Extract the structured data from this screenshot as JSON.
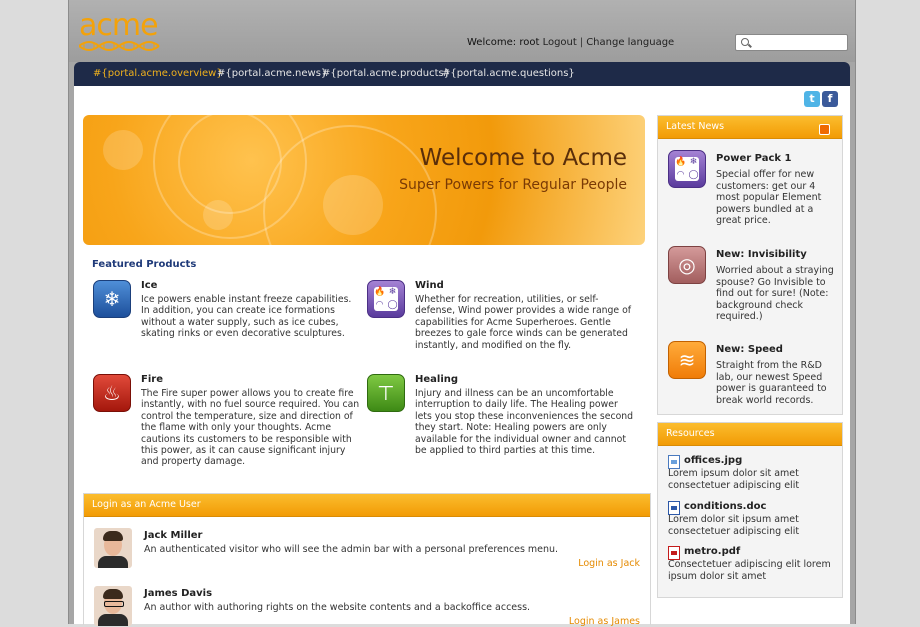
{
  "header": {
    "logo_text": "acme",
    "welcome_label": "Welcome:",
    "username": "root",
    "logout_label": "Logout",
    "separator": "|",
    "change_language_label": "Change language",
    "search_placeholder": ""
  },
  "nav": {
    "tabs": [
      {
        "label": "#{portal.acme.overview}",
        "active": true
      },
      {
        "label": "#{portal.acme.news}",
        "active": false
      },
      {
        "label": "#{portal.acme.products}",
        "active": false
      },
      {
        "label": "#{portal.acme.questions}",
        "active": false
      }
    ]
  },
  "social": {
    "twitter": "t",
    "facebook": "f"
  },
  "banner": {
    "title": "Welcome to Acme",
    "subtitle": "Super Powers for Regular People"
  },
  "featured": {
    "title": "Featured Products",
    "products": [
      {
        "name": "Ice",
        "icon": "snowflake-icon",
        "desc": "Ice powers enable instant freeze capabilities. In addition, you can create ice formations without a water supply, such as ice cubes, skating rinks or even decorative sculptures."
      },
      {
        "name": "Wind",
        "icon": "elements-icon",
        "desc": "Whether for recreation, utilities, or self-defense, Wind power provides a wide range of capabilities for Acme Superheroes. Gentle breezes to gale force winds can be generated instantly, and modified on the fly."
      },
      {
        "name": "Fire",
        "icon": "flame-icon",
        "desc": "The Fire super power allows you to create fire instantly, with no fuel source required. You can control the temperature, size and direction of the flame with only your thoughts. Acme cautions its customers to be responsible with this power, as it can cause significant injury and property damage."
      },
      {
        "name": "Healing",
        "icon": "healing-icon",
        "desc": "Injury and illness can be an uncomfortable interruption to daily life. The Healing power lets you stop these inconveniences the second they start. Note: Healing powers are only available for the individual owner and cannot be applied to third parties at this time."
      }
    ]
  },
  "login": {
    "title": "Login as an Acme User",
    "users": [
      {
        "name": "Jack Miller",
        "desc": "An authenticated visitor who will see the admin bar with a personal preferences menu.",
        "link": "Login as Jack"
      },
      {
        "name": "James Davis",
        "desc": "An author with authoring rights on the website contents and a backoffice access.",
        "link": "Login as James"
      }
    ]
  },
  "news": {
    "title": "Latest News",
    "items": [
      {
        "title": "Power Pack 1",
        "icon": "elements-icon",
        "desc": "Special offer for new customers: get our 4 most popular Element powers bundled at a great price."
      },
      {
        "title": "New: Invisibility",
        "icon": "invisibility-icon",
        "desc": "Worried about a straying spouse? Go Invisible to find out for sure! (Note: background check required.)"
      },
      {
        "title": "New: Speed",
        "icon": "speed-icon",
        "desc": "Straight from the R&D lab, our newest Speed power is guaranteed to break world records."
      }
    ]
  },
  "resources": {
    "title": "Resources",
    "items": [
      {
        "name": "offices.jpg",
        "type": "img",
        "desc": "Lorem ipsum dolor sit amet consectetuer adipiscing elit"
      },
      {
        "name": "conditions.doc",
        "type": "doc",
        "desc": "Lorem dolor sit ipsum amet consectetuer adipiscing elit"
      },
      {
        "name": "metro.pdf",
        "type": "pdf",
        "desc": "Consectetuer adipiscing elit lorem ipsum dolor sit amet"
      }
    ]
  },
  "colors": {
    "accent": "#f29b05",
    "nav": "#1e2a48",
    "link": "#e58a00"
  }
}
